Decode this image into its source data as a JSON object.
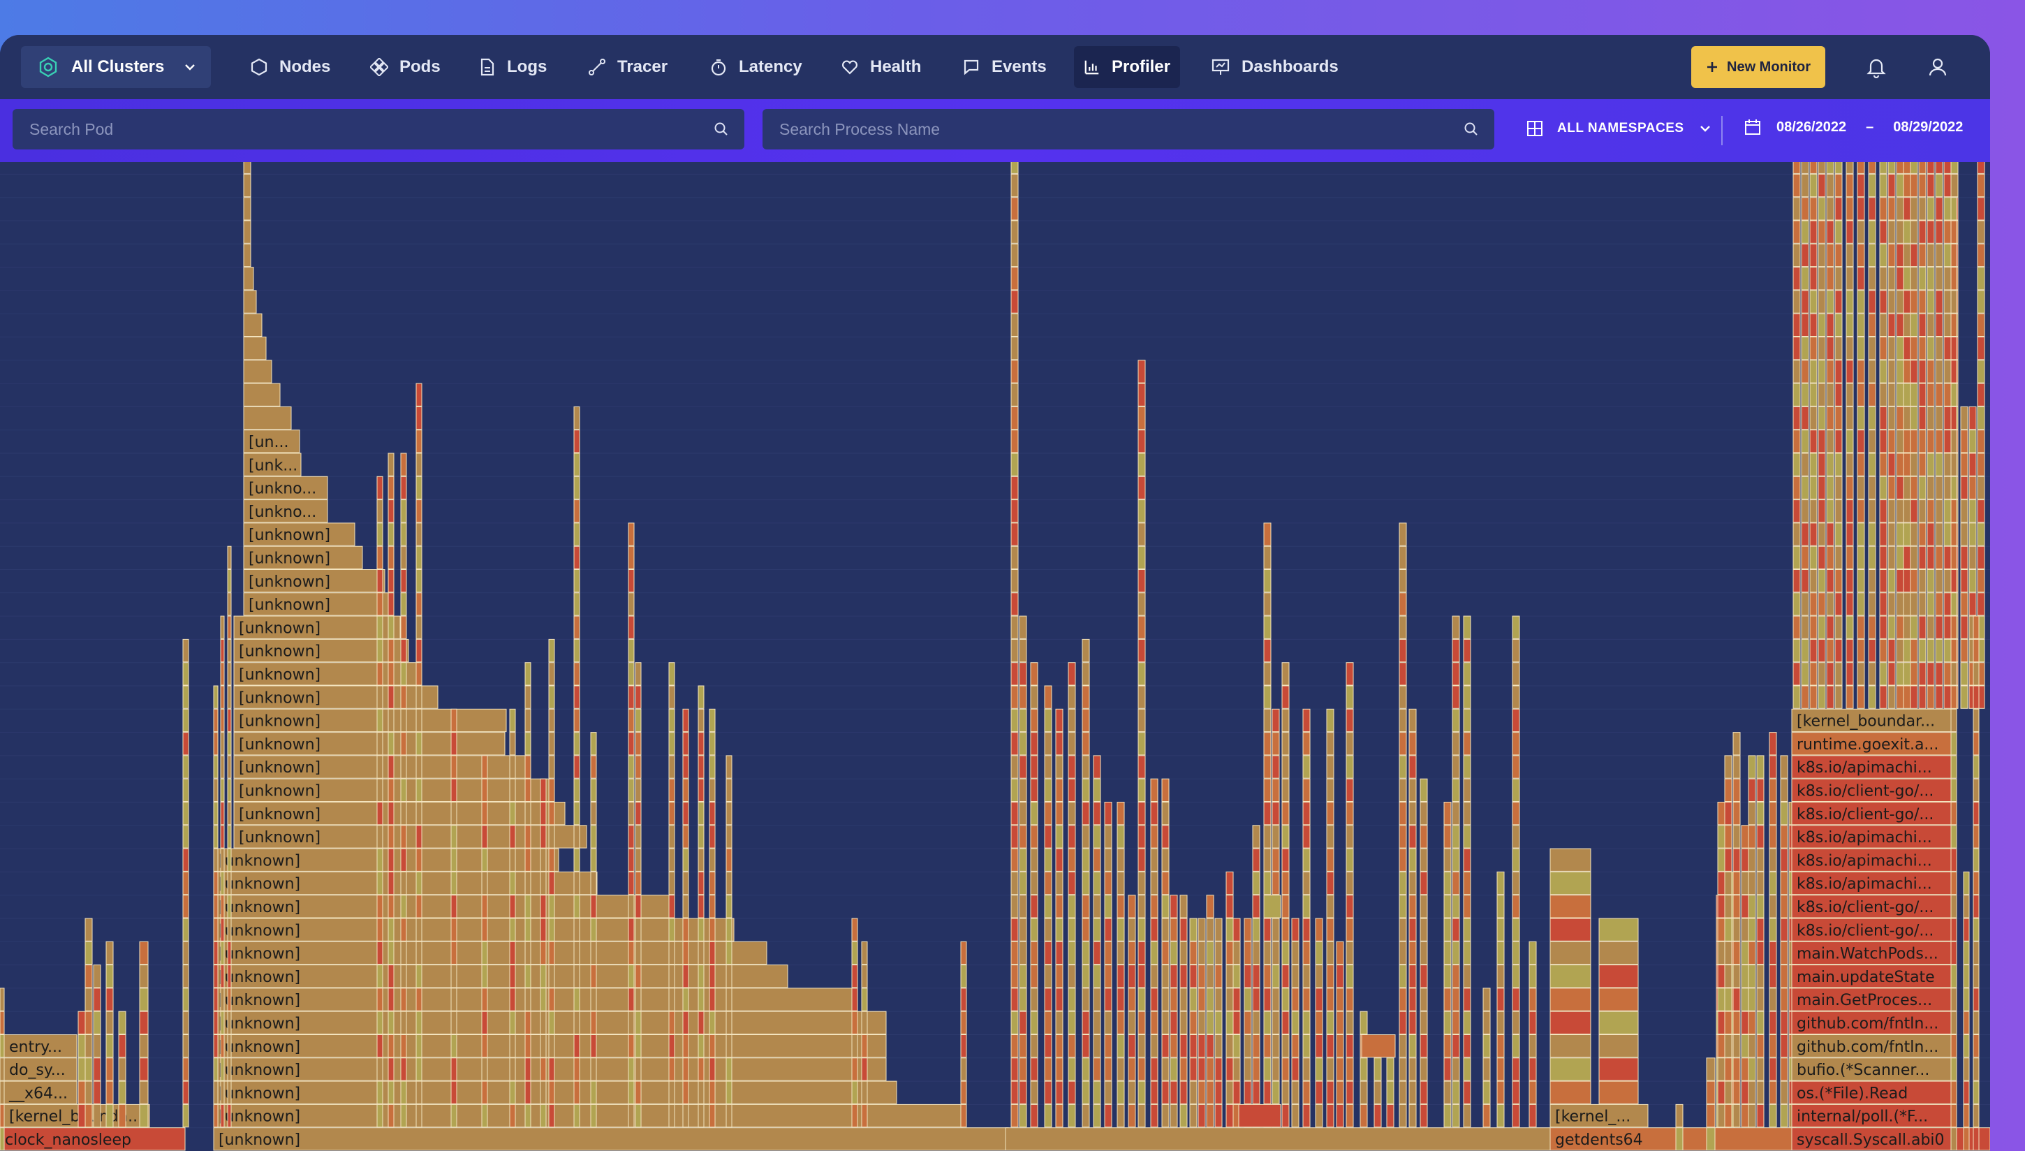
{
  "nav": {
    "cluster_label": "All Clusters",
    "items": [
      {
        "label": "Nodes",
        "icon": "hexagon-icon"
      },
      {
        "label": "Pods",
        "icon": "pods-icon"
      },
      {
        "label": "Logs",
        "icon": "document-icon"
      },
      {
        "label": "Tracer",
        "icon": "route-icon"
      },
      {
        "label": "Latency",
        "icon": "stopwatch-icon"
      },
      {
        "label": "Health",
        "icon": "heart-icon"
      },
      {
        "label": "Events",
        "icon": "chat-icon"
      },
      {
        "label": "Profiler",
        "icon": "bar-chart-icon",
        "active": true
      },
      {
        "label": "Dashboards",
        "icon": "presentation-icon"
      }
    ],
    "new_monitor_label": "New Monitor"
  },
  "filters": {
    "search_pod_placeholder": "Search Pod",
    "search_process_placeholder": "Search Process Name",
    "namespace_label": "ALL NAMESPACES",
    "date_from": "08/26/2022",
    "date_sep": "–",
    "date_to": "08/29/2022"
  },
  "flame": {
    "colors": {
      "tan": "#b2884d",
      "olive": "#b1a452",
      "orange": "#c86f3d",
      "red": "#c84a37",
      "bg": "#253263",
      "grid": "#2d3a6d"
    },
    "left_labels_bottom_up": [
      "clock_nanosleep",
      "[kernel_bounda...",
      "__x64...",
      "do_sy...",
      "entry..."
    ],
    "main_labels_bottom_up": [
      "[unknown]",
      "[unknown]",
      "[unknown]",
      "[unknown]",
      "[unknown]",
      "[unknown]",
      "[unknown]",
      "[unknown]",
      "[unknown]",
      "[unknown]",
      "[unknown]",
      "[unknown]",
      "[unknown]",
      "[unknown]",
      "[unknown]",
      "[unknown]",
      "[unknown]",
      "[unknown]",
      "[unknown]",
      "[unknown]",
      "[unknown]",
      "[unknown]",
      "[unknown]",
      "[unknown]",
      "[unknown]",
      "[unknown]",
      "[unknown]",
      "[unkno...",
      "[unkno...",
      "[unk...",
      "[un..."
    ],
    "mid_labels_bottom_up": [
      "getdents64",
      "[kernel_..."
    ],
    "right_labels_bottom_up": [
      "syscall.Syscall.abi0",
      "internal/poll.(*F...",
      "os.(*File).Read",
      "bufio.(*Scanner...",
      "github.com/fntln...",
      "github.com/fntln...",
      "main.GetProces...",
      "main.updateState",
      "main.WatchPods...",
      "k8s.io/client-go/...",
      "k8s.io/client-go/...",
      "k8s.io/apimachi...",
      "k8s.io/apimachi...",
      "k8s.io/apimachi...",
      "k8s.io/client-go/...",
      "k8s.io/client-go/...",
      "k8s.io/apimachi...",
      "runtime.goexit.a...",
      "[kernel_boundar..."
    ]
  }
}
